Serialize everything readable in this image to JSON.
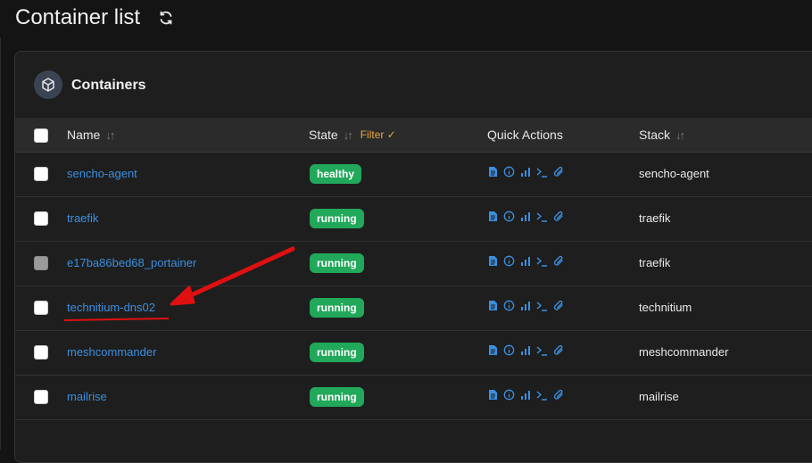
{
  "page": {
    "title": "Container list"
  },
  "panel": {
    "title": "Containers"
  },
  "columns": {
    "name": "Name",
    "state": "State",
    "filter": "Filter",
    "quick_actions": "Quick Actions",
    "stack": "Stack"
  },
  "rows": [
    {
      "name": "sencho-agent",
      "state": "healthy",
      "stack": "sencho-agent"
    },
    {
      "name": "traefik",
      "state": "running",
      "stack": "traefik"
    },
    {
      "name": "e17ba86bed68_portainer",
      "state": "running",
      "stack": "traefik"
    },
    {
      "name": "technitium-dns02",
      "state": "running",
      "stack": "technitium"
    },
    {
      "name": "meshcommander",
      "state": "running",
      "stack": "meshcommander"
    },
    {
      "name": "mailrise",
      "state": "running",
      "stack": "mailrise"
    }
  ],
  "colors": {
    "link": "#3b8fe0",
    "badge": "#21a85a",
    "annotation": "#e01010",
    "filter": "#e8a640"
  }
}
